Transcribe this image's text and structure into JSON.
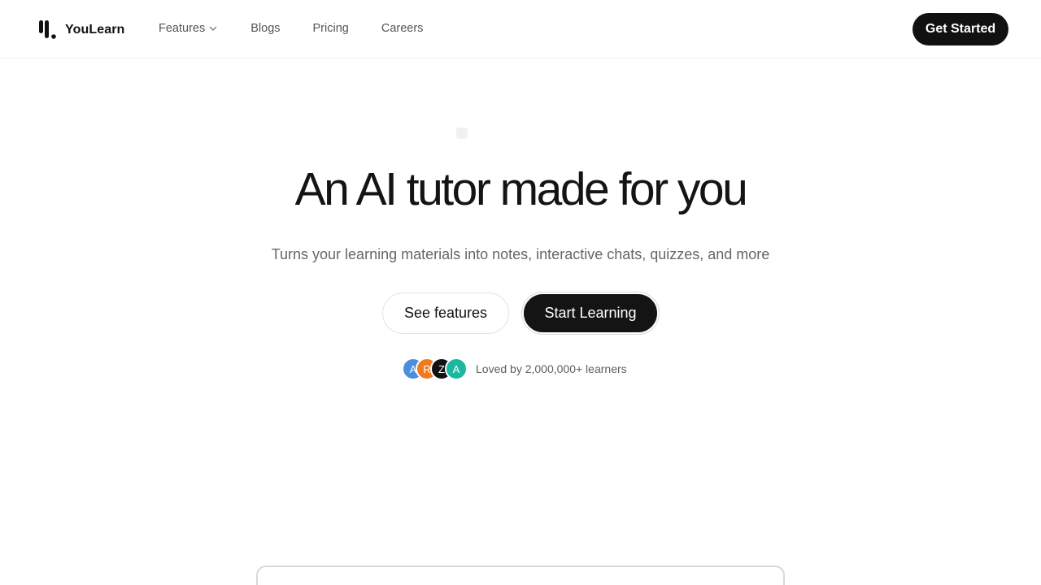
{
  "brand": {
    "name": "YouLearn"
  },
  "nav": {
    "items": [
      {
        "label": "Features",
        "has_dropdown": true,
        "icon": "chevron-down-icon"
      },
      {
        "label": "Blogs"
      },
      {
        "label": "Pricing"
      },
      {
        "label": "Careers"
      }
    ],
    "cta": "Get Started"
  },
  "hero": {
    "title": "An AI tutor made for you",
    "subtitle": "Turns your learning materials into notes, interactive chats, quizzes, and more",
    "buttons": {
      "secondary": "See features",
      "primary": "Start Learning"
    },
    "social_proof": {
      "avatars": [
        {
          "initial": "A",
          "color": "#4a8ee0"
        },
        {
          "initial": "R",
          "color": "#f07b1e"
        },
        {
          "initial": "Z",
          "color": "#111111"
        },
        {
          "initial": "A",
          "color": "#1ab8a0"
        }
      ],
      "text": "Loved by 2,000,000+ learners"
    }
  },
  "colors": {
    "primary": "#111111",
    "background": "#ffffff",
    "muted_text": "#666666"
  }
}
